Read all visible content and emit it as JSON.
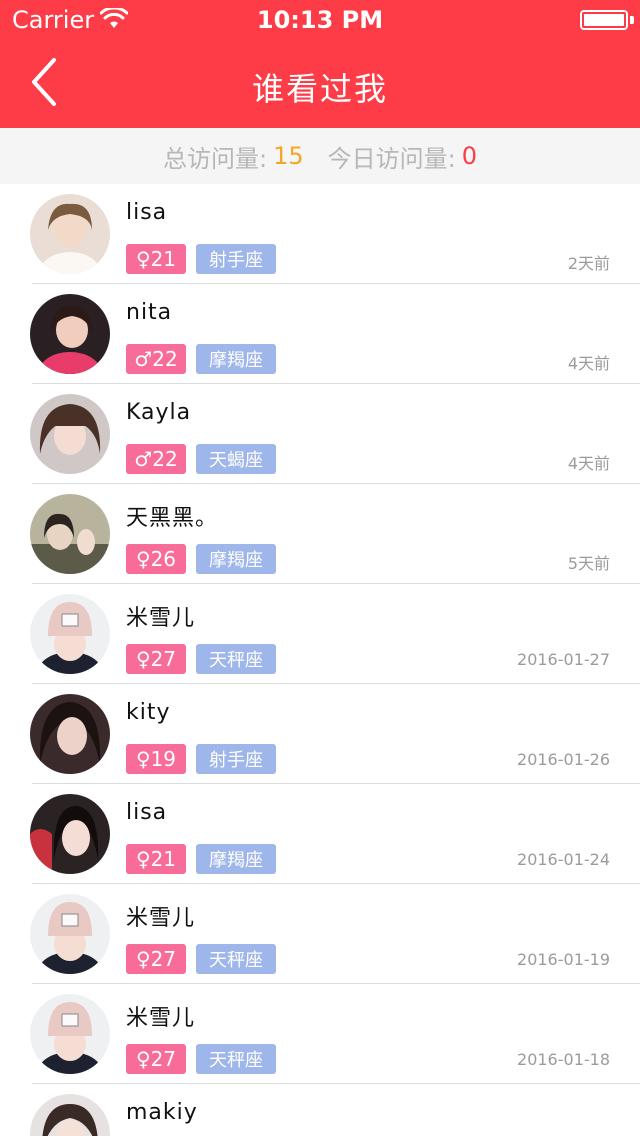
{
  "status_bar": {
    "carrier": "Carrier",
    "time": "10:13 PM"
  },
  "nav": {
    "title": "谁看过我",
    "back_icon": "chevron-left-icon"
  },
  "stats": {
    "total_label": "总访问量:",
    "total_value": "15",
    "today_label": "今日访问量:",
    "today_value": "0",
    "colors": {
      "total": "#f5a623",
      "today": "#fd3c47"
    }
  },
  "colors": {
    "brand": "#fd3c47",
    "gender_badge": "#f76c98",
    "zodiac_badge": "#9eb6ea"
  },
  "visitors": [
    {
      "name": "lisa",
      "gender_age": "♀21",
      "zodiac": "射手座",
      "time": "2天前"
    },
    {
      "name": "nita",
      "gender_age": "♂22",
      "zodiac": "摩羯座",
      "time": "4天前"
    },
    {
      "name": "Kayla",
      "gender_age": "♂22",
      "zodiac": "天蝎座",
      "time": "4天前"
    },
    {
      "name": "天黑黑。",
      "gender_age": "♀26",
      "zodiac": "摩羯座",
      "time": "5天前"
    },
    {
      "name": "米雪儿",
      "gender_age": "♀27",
      "zodiac": "天秤座",
      "time": "2016-01-27"
    },
    {
      "name": "kity",
      "gender_age": "♀19",
      "zodiac": "射手座",
      "time": "2016-01-26"
    },
    {
      "name": "lisa",
      "gender_age": "♀21",
      "zodiac": "摩羯座",
      "time": "2016-01-24"
    },
    {
      "name": "米雪儿",
      "gender_age": "♀27",
      "zodiac": "天秤座",
      "time": "2016-01-19"
    },
    {
      "name": "米雪儿",
      "gender_age": "♀27",
      "zodiac": "天秤座",
      "time": "2016-01-18"
    },
    {
      "name": "makiy",
      "gender_age": "",
      "zodiac": "",
      "time": ""
    }
  ]
}
